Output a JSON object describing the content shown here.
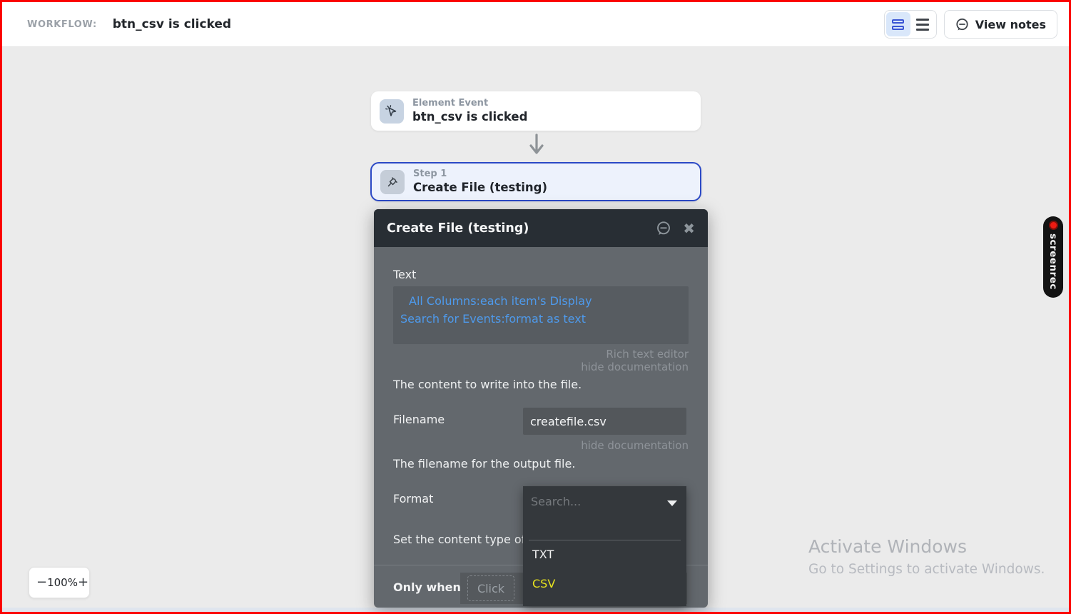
{
  "topbar": {
    "workflow_label": "WORKFLOW:",
    "workflow_title": "btn_csv is clicked",
    "view_notes_label": "View notes"
  },
  "canvas": {
    "event_card": {
      "type_label": "Element Event",
      "title": "btn_csv is clicked"
    },
    "step_card": {
      "step_label": "Step 1",
      "title": "Create File (testing)"
    },
    "zoom_control": {
      "minus": "−",
      "level": "100%",
      "plus": "+"
    }
  },
  "modal": {
    "title": "Create File (testing)",
    "text_field": {
      "label": "Text",
      "expression_line1": "All Columns:each item's Display",
      "expression_line2": "Search for Events:format as text",
      "rich_text_editor_link": "Rich text editor",
      "hide_documentation_link": "hide documentation",
      "help_text": "The content to write into the file."
    },
    "filename_field": {
      "label": "Filename",
      "value": "createfile.csv",
      "hide_documentation_link": "hide documentation",
      "help_text": "The filename for the output file."
    },
    "format_field": {
      "label": "Format",
      "help_text": "Set the content type of the",
      "dropdown": {
        "search_placeholder": "Search...",
        "options": [
          {
            "label": "TXT",
            "color": "#f2f2f2"
          },
          {
            "label": "CSV",
            "color": "#e7e31f"
          }
        ]
      }
    },
    "only_when": {
      "label": "Only when",
      "placeholder": "Click"
    }
  },
  "watermarks": {
    "screenrec_label": "screenrec",
    "activate_windows_line1": "Activate Windows",
    "activate_windows_line2": "Go to Settings to activate Windows."
  },
  "colors": {
    "frame_border": "#fb0100",
    "canvas_bg": "#ebebeb",
    "modal_header_bg": "#282e34",
    "modal_body_bg": "#63686d",
    "step_card_border": "#2b49c6",
    "expression_blue": "#4e9aec",
    "csv_option_yellow": "#e7e31f",
    "selected_segment_bg": "#d9e7fa"
  }
}
